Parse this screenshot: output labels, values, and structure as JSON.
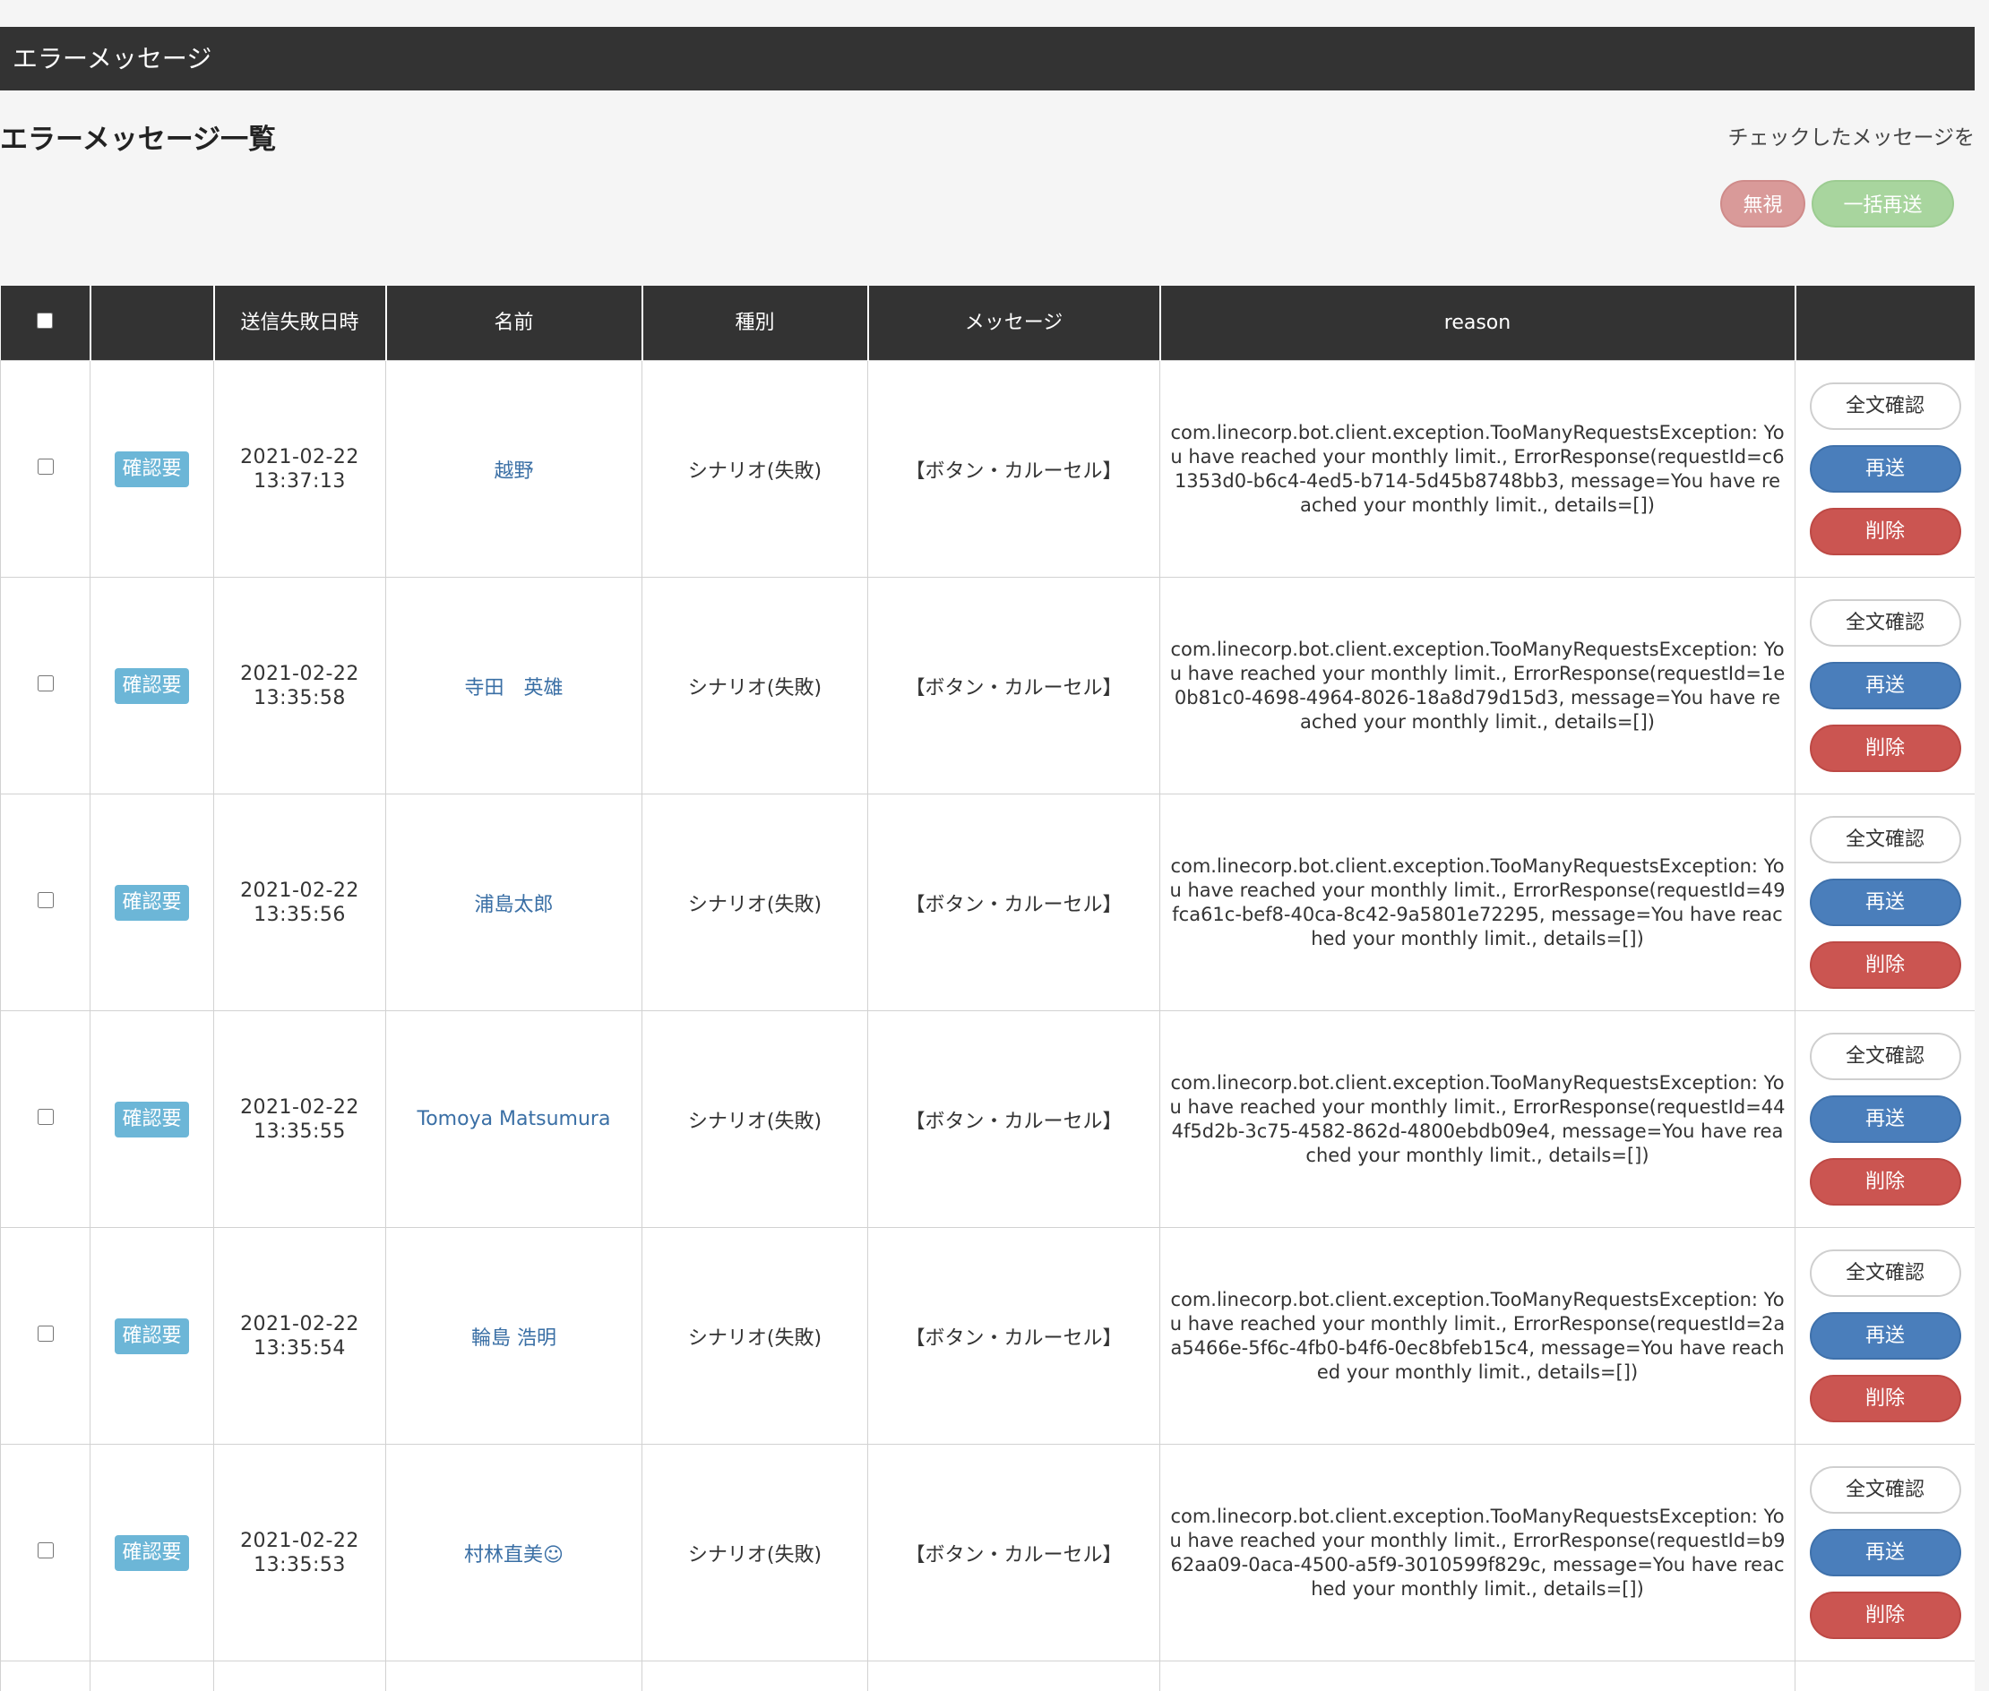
{
  "header": {
    "title": "エラーメッセージ"
  },
  "main": {
    "heading": "エラーメッセージ一覧",
    "bulk_caption": "チェックしたメッセージを",
    "ignore_label": "無視",
    "bulk_resend_label": "一括再送"
  },
  "table": {
    "columns": {
      "checkbox": "",
      "status": "",
      "failed_at": "送信失敗日時",
      "name": "名前",
      "type": "種別",
      "message": "メッセージ",
      "reason": "reason",
      "actions": ""
    },
    "action_labels": {
      "full_text": "全文確認",
      "resend": "再送",
      "delete": "削除"
    },
    "rows": [
      {
        "status": "確認要",
        "date": "2021-02-22",
        "time": "13:37:13",
        "name": "越野",
        "type": "シナリオ(失敗)",
        "message": "【ボタン・カルーセル】",
        "reason": "com.linecorp.bot.client.exception.TooManyRequestsException: You have reached your monthly limit., ErrorResponse(requestId=c61353d0-b6c4-4ed5-b714-5d45b8748bb3, message=You have reached your monthly limit., details=[])"
      },
      {
        "status": "確認要",
        "date": "2021-02-22",
        "time": "13:35:58",
        "name": "寺田　英雄",
        "type": "シナリオ(失敗)",
        "message": "【ボタン・カルーセル】",
        "reason": "com.linecorp.bot.client.exception.TooManyRequestsException: You have reached your monthly limit., ErrorResponse(requestId=1e0b81c0-4698-4964-8026-18a8d79d15d3, message=You have reached your monthly limit., details=[])"
      },
      {
        "status": "確認要",
        "date": "2021-02-22",
        "time": "13:35:56",
        "name": "浦島太郎",
        "type": "シナリオ(失敗)",
        "message": "【ボタン・カルーセル】",
        "reason": "com.linecorp.bot.client.exception.TooManyRequestsException: You have reached your monthly limit., ErrorResponse(requestId=49fca61c-bef8-40ca-8c42-9a5801e72295, message=You have reached your monthly limit., details=[])"
      },
      {
        "status": "確認要",
        "date": "2021-02-22",
        "time": "13:35:55",
        "name": "Tomoya Matsumura",
        "type": "シナリオ(失敗)",
        "message": "【ボタン・カルーセル】",
        "reason": "com.linecorp.bot.client.exception.TooManyRequestsException: You have reached your monthly limit., ErrorResponse(requestId=444f5d2b-3c75-4582-862d-4800ebdb09e4, message=You have reached your monthly limit., details=[])"
      },
      {
        "status": "確認要",
        "date": "2021-02-22",
        "time": "13:35:54",
        "name": "輪島 浩明",
        "type": "シナリオ(失敗)",
        "message": "【ボタン・カルーセル】",
        "reason": "com.linecorp.bot.client.exception.TooManyRequestsException: You have reached your monthly limit., ErrorResponse(requestId=2aa5466e-5f6c-4fb0-b4f6-0ec8bfeb15c4, message=You have reached your monthly limit., details=[])"
      },
      {
        "status": "確認要",
        "date": "2021-02-22",
        "time": "13:35:53",
        "name": "村林直美☺",
        "type": "シナリオ(失敗)",
        "message": "【ボタン・カルーセル】",
        "reason": "com.linecorp.bot.client.exception.TooManyRequestsException: You have reached your monthly limit., ErrorResponse(requestId=b962aa09-0aca-4500-a5f9-3010599f829c, message=You have reached your monthly limit., details=[])"
      }
    ]
  }
}
